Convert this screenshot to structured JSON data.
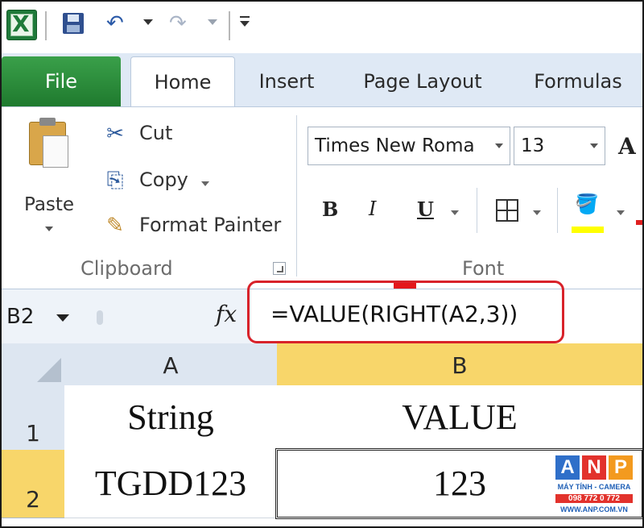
{
  "colors": {
    "ribbon_tab_file": "#2e8b3a",
    "highlight": "#e4171b",
    "selected_header": "#f8d66a",
    "fill_color": "#ffff00"
  },
  "quick_access": {
    "icons": [
      "excel-logo-icon",
      "save-icon",
      "undo-icon",
      "redo-icon",
      "customize-icon"
    ]
  },
  "tabs": [
    {
      "label": "File"
    },
    {
      "label": "Home"
    },
    {
      "label": "Insert"
    },
    {
      "label": "Page Layout"
    },
    {
      "label": "Formulas"
    }
  ],
  "clipboard": {
    "paste_label": "Paste",
    "cut_label": "Cut",
    "copy_label": "Copy",
    "format_painter_label": "Format Painter",
    "group_label": "Clipboard"
  },
  "font": {
    "font_name": "Times New Roma",
    "font_size": "13",
    "bold_label": "B",
    "italic_label": "I",
    "underline_label": "U",
    "group_label": "Font",
    "grow_font_label": "A"
  },
  "formula_bar": {
    "name_box": "B2",
    "fx_label": "fx",
    "formula": "=VALUE(RIGHT(A2,3))"
  },
  "sheet": {
    "columns": [
      "A",
      "B"
    ],
    "rows": [
      "1",
      "2"
    ],
    "cells": {
      "A1": "String",
      "B1": "VALUE",
      "A2": "TGDD123",
      "B2": "123"
    }
  },
  "watermark": {
    "letters": [
      "A",
      "N",
      "P"
    ],
    "line1": "MÁY TÍNH - CAMERA",
    "line2": "098 772 0 772",
    "line3": "WWW.ANP.COM.VN"
  }
}
